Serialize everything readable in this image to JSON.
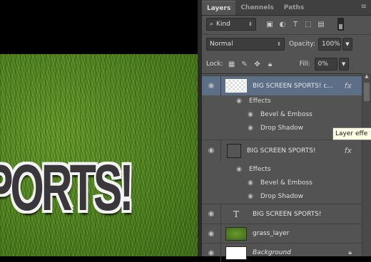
{
  "tabs": [
    {
      "label": "Layers"
    },
    {
      "label": "Channels"
    },
    {
      "label": "Paths"
    }
  ],
  "filter": {
    "kind_label": "Kind"
  },
  "blend": {
    "mode": "Normal",
    "opacity_label": "Opacity:",
    "opacity_value": "100%"
  },
  "lock": {
    "label": "Lock:",
    "fill_label": "Fill:",
    "fill_value": "0%"
  },
  "canvas": {
    "art_text": "PORTS!"
  },
  "layers": [
    {
      "name": "BIG SCREEN SPORTS! c...",
      "effects_label": "Effects",
      "effects": [
        "Bevel & Emboss",
        "Drop Shadow"
      ]
    },
    {
      "name": "BIG SCREEN SPORTS!",
      "effects_label": "Effects",
      "effects": [
        "Bevel & Emboss",
        "Drop Shadow"
      ]
    },
    {
      "name": "BIG SCREEN SPORTS!"
    },
    {
      "name": "grass_layer"
    },
    {
      "name": "Background"
    }
  ],
  "tooltip": "Layer effe",
  "colors": {
    "panel_bg": "#535353",
    "selected_layer": "#5c6f87",
    "text_fill": "#3a373b",
    "text_stroke": "#f2f2f2"
  }
}
